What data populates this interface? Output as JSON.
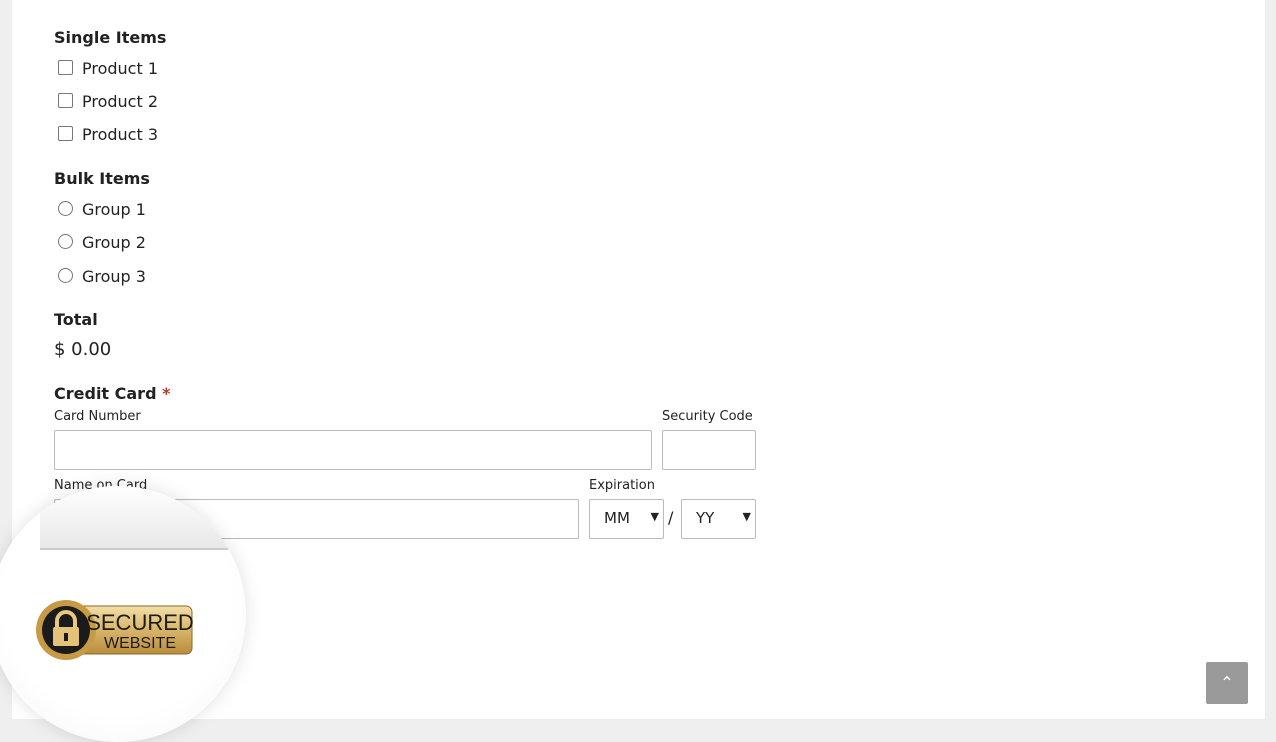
{
  "single_items": {
    "heading": "Single Items",
    "options": [
      "Product 1",
      "Product 2",
      "Product 3"
    ]
  },
  "bulk_items": {
    "heading": "Bulk Items",
    "options": [
      "Group 1",
      "Group 2",
      "Group 3"
    ]
  },
  "total": {
    "heading": "Total",
    "value": "$ 0.00"
  },
  "credit_card": {
    "heading": "Credit Card",
    "required_mark": "*",
    "card_number_label": "Card Number",
    "security_code_label": "Security Code",
    "name_on_card_label": "Name on Card",
    "expiration_label": "Expiration",
    "month_value": "MM",
    "year_value": "YY",
    "separator": "/"
  },
  "badge": {
    "line1": "SECURED",
    "line2": "WEBSITE"
  },
  "scroll_top_icon": "chevron-up-icon"
}
